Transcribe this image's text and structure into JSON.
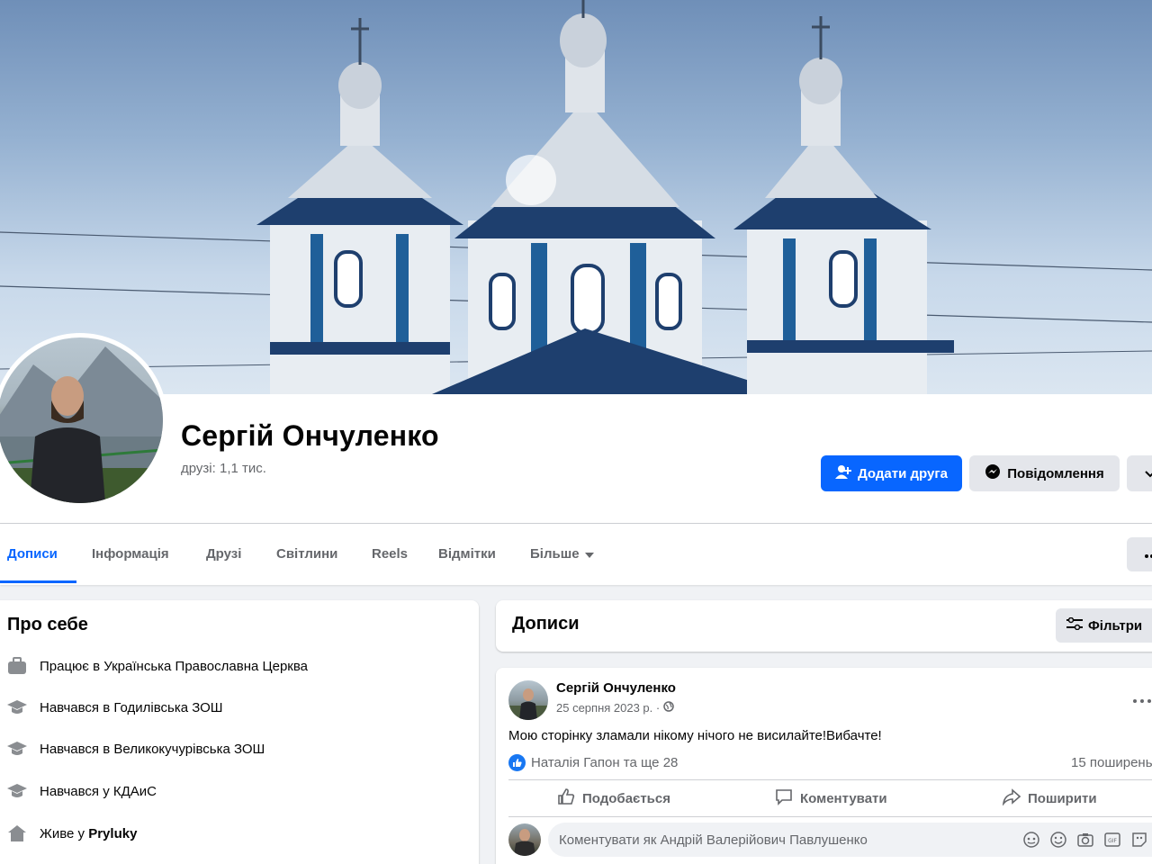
{
  "profile": {
    "name": "Сергій Ончуленко",
    "friends": "друзі: 1,1 тис."
  },
  "actions": {
    "add_friend": "Додати друга",
    "message": "Повідомлення"
  },
  "tabs": [
    {
      "label": "Дописи",
      "active": true
    },
    {
      "label": "Інформація"
    },
    {
      "label": "Друзі"
    },
    {
      "label": "Світлини"
    },
    {
      "label": "Reels"
    },
    {
      "label": "Відмітки"
    },
    {
      "label": "Більше"
    }
  ],
  "about": {
    "title": "Про себе",
    "items": [
      {
        "prefix": "Працює в ",
        "value": "Українська Православна Церква",
        "icon": "briefcase-icon"
      },
      {
        "prefix": "Навчався в ",
        "value": "Годилівська ЗОШ",
        "icon": "graduation-cap-icon"
      },
      {
        "prefix": "Навчався в ",
        "value": "Великокучурівська ЗОШ",
        "icon": "graduation-cap-icon"
      },
      {
        "prefix": "Навчався у ",
        "value": "КДАиС",
        "icon": "graduation-cap-icon"
      },
      {
        "prefix": "Живе у ",
        "value": "Pryluky",
        "icon": "home-icon"
      }
    ]
  },
  "posts_section": {
    "title": "Дописи",
    "filter_label": "Фільтри"
  },
  "post": {
    "author": "Сергій Ончуленко",
    "date": "25 серпня 2023 р. ·",
    "text": "Мою сторінку зламали нікому нічого не висилайте!Вибачте!",
    "reactions": "Наталія Гапон та ще 28",
    "shares": "15 поширень",
    "like_label": "Подобається",
    "comment_label": "Коментувати",
    "share_label": "Поширити",
    "comment_placeholder": "Коментувати як Андрій Валерійович Павлушенко"
  },
  "colors": {
    "accent": "#0866ff",
    "page_bg": "#f0f2f5",
    "secondary_btn": "#e4e6eb"
  }
}
